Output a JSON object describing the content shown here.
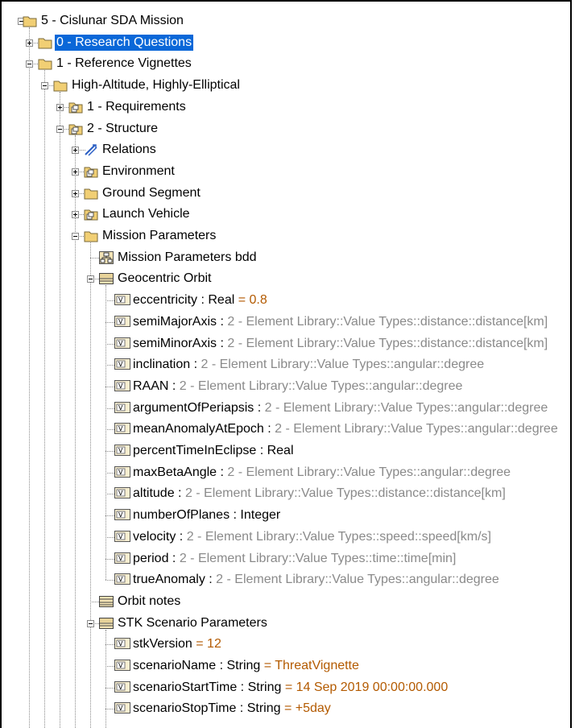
{
  "tree": [
    {
      "level": 0,
      "expander": "minus",
      "icon": "folder",
      "parts": [
        {
          "k": "name",
          "t": "5 - Cislunar SDA Mission"
        }
      ]
    },
    {
      "level": 1,
      "expander": "plus",
      "icon": "folder",
      "selected": true,
      "parts": [
        {
          "k": "name",
          "t": "0 - Research Questions"
        }
      ]
    },
    {
      "level": 1,
      "expander": "minus",
      "icon": "folder",
      "parts": [
        {
          "k": "name",
          "t": "1 - Reference Vignettes"
        }
      ]
    },
    {
      "level": 2,
      "expander": "minus",
      "icon": "folder",
      "parts": [
        {
          "k": "name",
          "t": "High-Altitude, Highly-Elliptical"
        }
      ]
    },
    {
      "level": 3,
      "expander": "plus",
      "icon": "package",
      "parts": [
        {
          "k": "name",
          "t": "1 - Requirements"
        }
      ]
    },
    {
      "level": 3,
      "expander": "minus",
      "icon": "package",
      "parts": [
        {
          "k": "name",
          "t": "2 - Structure"
        }
      ]
    },
    {
      "level": 4,
      "expander": "plus",
      "icon": "relations",
      "parts": [
        {
          "k": "name",
          "t": "Relations"
        }
      ]
    },
    {
      "level": 4,
      "expander": "plus",
      "icon": "package",
      "parts": [
        {
          "k": "name",
          "t": "Environment"
        }
      ]
    },
    {
      "level": 4,
      "expander": "plus",
      "icon": "folder",
      "parts": [
        {
          "k": "name",
          "t": "Ground Segment"
        }
      ]
    },
    {
      "level": 4,
      "expander": "plus",
      "icon": "package",
      "parts": [
        {
          "k": "name",
          "t": "Launch Vehicle"
        }
      ]
    },
    {
      "level": 4,
      "expander": "minus",
      "icon": "folder",
      "parts": [
        {
          "k": "name",
          "t": "Mission Parameters"
        }
      ]
    },
    {
      "level": 5,
      "expander": "none",
      "icon": "bdd",
      "parts": [
        {
          "k": "name",
          "t": "Mission Parameters bdd"
        }
      ]
    },
    {
      "level": 5,
      "expander": "minus",
      "icon": "block",
      "parts": [
        {
          "k": "name",
          "t": "Geocentric Orbit"
        }
      ]
    },
    {
      "level": 6,
      "expander": "none",
      "icon": "value",
      "parts": [
        {
          "k": "name",
          "t": "eccentricity"
        },
        {
          "k": "name",
          "t": " : Real "
        },
        {
          "k": "val",
          "t": "= 0.8"
        }
      ]
    },
    {
      "level": 6,
      "expander": "none",
      "icon": "value",
      "parts": [
        {
          "k": "name",
          "t": "semiMajorAxis"
        },
        {
          "k": "name",
          "t": " : "
        },
        {
          "k": "type",
          "t": "2 - Element Library::Value Types::distance::distance[km]"
        }
      ]
    },
    {
      "level": 6,
      "expander": "none",
      "icon": "value",
      "parts": [
        {
          "k": "name",
          "t": "semiMinorAxis"
        },
        {
          "k": "name",
          "t": " : "
        },
        {
          "k": "type",
          "t": "2 - Element Library::Value Types::distance::distance[km]"
        }
      ]
    },
    {
      "level": 6,
      "expander": "none",
      "icon": "value",
      "parts": [
        {
          "k": "name",
          "t": "inclination"
        },
        {
          "k": "name",
          "t": " : "
        },
        {
          "k": "type",
          "t": "2 - Element Library::Value Types::angular::degree"
        }
      ]
    },
    {
      "level": 6,
      "expander": "none",
      "icon": "value",
      "parts": [
        {
          "k": "name",
          "t": "RAAN"
        },
        {
          "k": "name",
          "t": " : "
        },
        {
          "k": "type",
          "t": "2 - Element Library::Value Types::angular::degree"
        }
      ]
    },
    {
      "level": 6,
      "expander": "none",
      "icon": "value",
      "parts": [
        {
          "k": "name",
          "t": "argumentOfPeriapsis"
        },
        {
          "k": "name",
          "t": " : "
        },
        {
          "k": "type",
          "t": "2 - Element Library::Value Types::angular::degree"
        }
      ]
    },
    {
      "level": 6,
      "expander": "none",
      "icon": "value",
      "parts": [
        {
          "k": "name",
          "t": "meanAnomalyAtEpoch"
        },
        {
          "k": "name",
          "t": " : "
        },
        {
          "k": "type",
          "t": "2 - Element Library::Value Types::angular::degree"
        }
      ]
    },
    {
      "level": 6,
      "expander": "none",
      "icon": "value",
      "parts": [
        {
          "k": "name",
          "t": "percentTimeInEclipse"
        },
        {
          "k": "name",
          "t": " : Real"
        }
      ]
    },
    {
      "level": 6,
      "expander": "none",
      "icon": "value",
      "parts": [
        {
          "k": "name",
          "t": "maxBetaAngle"
        },
        {
          "k": "name",
          "t": " : "
        },
        {
          "k": "type",
          "t": "2 - Element Library::Value Types::angular::degree"
        }
      ]
    },
    {
      "level": 6,
      "expander": "none",
      "icon": "value",
      "parts": [
        {
          "k": "name",
          "t": "altitude"
        },
        {
          "k": "name",
          "t": " : "
        },
        {
          "k": "type",
          "t": "2 - Element Library::Value Types::distance::distance[km]"
        }
      ]
    },
    {
      "level": 6,
      "expander": "none",
      "icon": "value",
      "parts": [
        {
          "k": "name",
          "t": "numberOfPlanes"
        },
        {
          "k": "name",
          "t": " : Integer"
        }
      ]
    },
    {
      "level": 6,
      "expander": "none",
      "icon": "value",
      "parts": [
        {
          "k": "name",
          "t": "velocity"
        },
        {
          "k": "name",
          "t": " : "
        },
        {
          "k": "type",
          "t": "2 - Element Library::Value Types::speed::speed[km/s]"
        }
      ]
    },
    {
      "level": 6,
      "expander": "none",
      "icon": "value",
      "parts": [
        {
          "k": "name",
          "t": "period"
        },
        {
          "k": "name",
          "t": " : "
        },
        {
          "k": "type",
          "t": "2 - Element Library::Value Types::time::time[min]"
        }
      ]
    },
    {
      "level": 6,
      "expander": "none",
      "icon": "value",
      "parts": [
        {
          "k": "name",
          "t": "trueAnomaly"
        },
        {
          "k": "name",
          "t": " : "
        },
        {
          "k": "type",
          "t": "2 - Element Library::Value Types::angular::degree"
        }
      ]
    },
    {
      "level": 5,
      "expander": "none",
      "icon": "notes",
      "parts": [
        {
          "k": "name",
          "t": "Orbit notes"
        }
      ]
    },
    {
      "level": 5,
      "expander": "minus",
      "icon": "block",
      "parts": [
        {
          "k": "name",
          "t": "STK Scenario Parameters"
        }
      ]
    },
    {
      "level": 6,
      "expander": "none",
      "icon": "value",
      "parts": [
        {
          "k": "name",
          "t": "stkVersion "
        },
        {
          "k": "val",
          "t": "= 12"
        }
      ]
    },
    {
      "level": 6,
      "expander": "none",
      "icon": "value",
      "parts": [
        {
          "k": "name",
          "t": "scenarioName"
        },
        {
          "k": "name",
          "t": " : String "
        },
        {
          "k": "val",
          "t": "= ThreatVignette"
        }
      ]
    },
    {
      "level": 6,
      "expander": "none",
      "icon": "value",
      "parts": [
        {
          "k": "name",
          "t": "scenarioStartTime"
        },
        {
          "k": "name",
          "t": " : String "
        },
        {
          "k": "val",
          "t": "= 14 Sep 2019 00:00:00.000"
        }
      ]
    },
    {
      "level": 6,
      "expander": "none",
      "icon": "value",
      "parts": [
        {
          "k": "name",
          "t": "scenarioStopTime"
        },
        {
          "k": "name",
          "t": " : String "
        },
        {
          "k": "val",
          "t": "= +5day"
        }
      ]
    }
  ],
  "icons": {
    "folder": "folder-icon",
    "package": "package-icon",
    "relations": "relations-icon",
    "bdd": "bdd-diagram-icon",
    "block": "block-icon",
    "value": "value-property-icon",
    "notes": "notes-icon"
  },
  "colors": {
    "selection": "#0a67d8",
    "type_text": "#8a8a8a",
    "value_text": "#b35a00",
    "folder": "#f1cf74"
  }
}
